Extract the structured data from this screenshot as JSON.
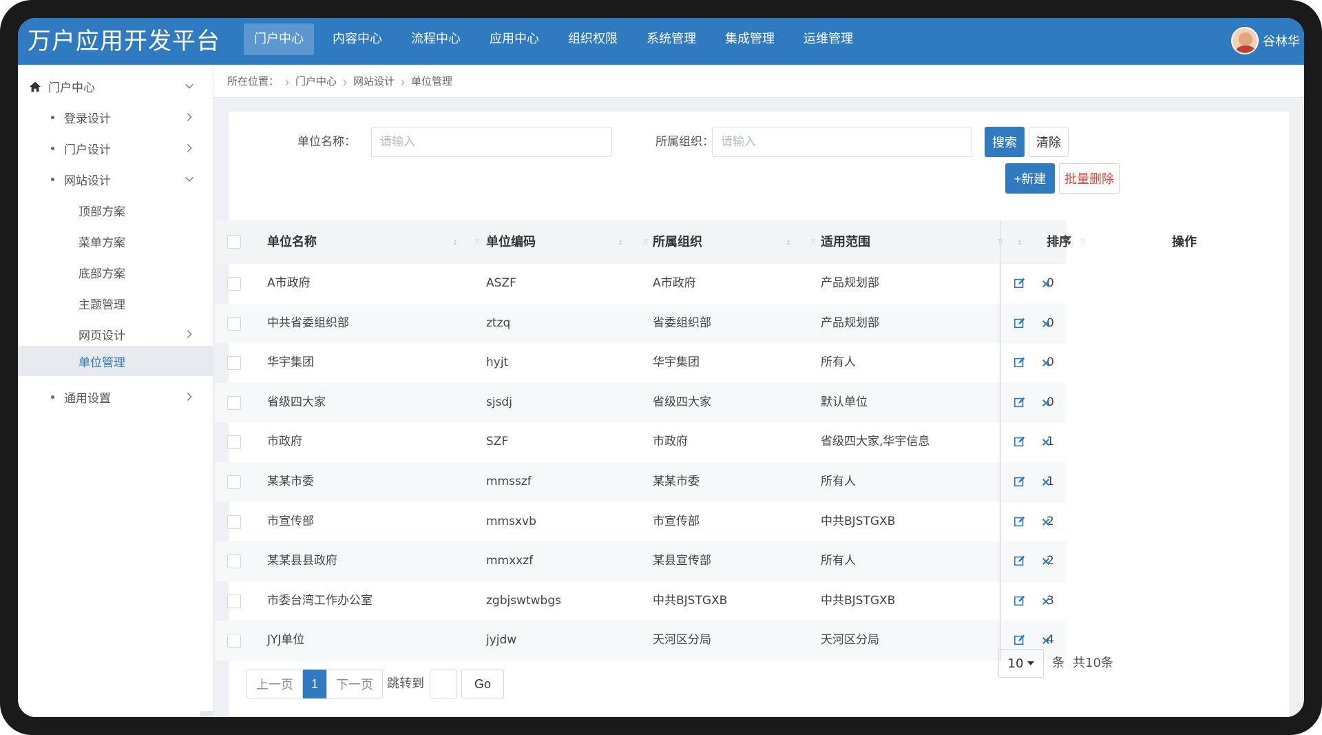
{
  "app": {
    "title": "万户应用开发平台"
  },
  "topnav": [
    {
      "label": "门户中心",
      "active": true
    },
    {
      "label": "内容中心",
      "active": false
    },
    {
      "label": "流程中心",
      "active": false
    },
    {
      "label": "应用中心",
      "active": false
    },
    {
      "label": "组织权限",
      "active": false
    },
    {
      "label": "系统管理",
      "active": false
    },
    {
      "label": "集成管理",
      "active": false
    },
    {
      "label": "运维管理",
      "active": false
    }
  ],
  "user": {
    "name": "谷林华"
  },
  "sidebar": {
    "items": [
      {
        "label": "门户中心",
        "icon": "home-icon",
        "chevron": "down"
      },
      {
        "label": "登录设计",
        "chevron": "right"
      },
      {
        "label": "门户设计",
        "chevron": "right"
      },
      {
        "label": "网站设计",
        "chevron": "down"
      },
      {
        "label": "顶部方案"
      },
      {
        "label": "菜单方案"
      },
      {
        "label": "底部方案"
      },
      {
        "label": "主题管理"
      },
      {
        "label": "网页设计",
        "chevron": "right"
      },
      {
        "label": "单位管理",
        "active": true
      },
      {
        "label": "通用设置",
        "chevron": "right"
      }
    ],
    "collapse_glyph": "«"
  },
  "breadcrumb": {
    "prefix": "所在位置：",
    "items": [
      "门户中心",
      "网站设计",
      "单位管理"
    ]
  },
  "search": {
    "unit_name_label": "单位名称：",
    "unit_name_placeholder": "请输入",
    "org_label": "所属组织：",
    "org_placeholder": "请输入",
    "search_button": "搜索",
    "clear_button": "清除"
  },
  "actions": {
    "new_button": "+新建",
    "batch_delete_button": "批量删除"
  },
  "table": {
    "columns": [
      "单位名称",
      "单位编码",
      "所属组织",
      "适用范围",
      "排序",
      "操作"
    ],
    "rows": [
      {
        "name": "A市政府",
        "code": "ASZF",
        "org": "A市政府",
        "scope": "产品规划部",
        "order": "0"
      },
      {
        "name": "中共省委组织部",
        "code": "ztzq",
        "org": "省委组织部",
        "scope": "产品规划部",
        "order": "0"
      },
      {
        "name": "华宇集团",
        "code": "hyjt",
        "org": "华宇集团",
        "scope": "所有人",
        "order": "0"
      },
      {
        "name": "省级四大家",
        "code": "sjsdj",
        "org": "省级四大家",
        "scope": "默认单位",
        "order": "0"
      },
      {
        "name": "市政府",
        "code": "SZF",
        "org": "市政府",
        "scope": "省级四大家,华宇信息",
        "order": "1"
      },
      {
        "name": "某某市委",
        "code": "mmsszf",
        "org": "某某市委",
        "scope": "所有人",
        "order": "1"
      },
      {
        "name": "市宣传部",
        "code": "mmsxvb",
        "org": "市宣传部",
        "scope": "中共BJSTGXB",
        "order": "2"
      },
      {
        "name": "某某县县政府",
        "code": "mmxxzf",
        "org": "某县宣传部",
        "scope": "所有人",
        "order": "2"
      },
      {
        "name": "市委台湾工作办公室",
        "code": "zgbjswtwbgs",
        "org": "中共BJSTGXB",
        "scope": "中共BJSTGXB",
        "order": "3"
      },
      {
        "name": "JYJ单位",
        "code": "jyjdw",
        "org": "天河区分局",
        "scope": "天河区分局",
        "order": "4"
      }
    ]
  },
  "pagination": {
    "prev": "上一页",
    "current": "1",
    "next": "下一页",
    "jump_label": "跳转到",
    "jump_value": "",
    "go": "Go",
    "page_size": "10",
    "unit": "条",
    "total": "共10条"
  },
  "colors": {
    "brand": "#2f7ac0",
    "danger": "#e2473f"
  }
}
